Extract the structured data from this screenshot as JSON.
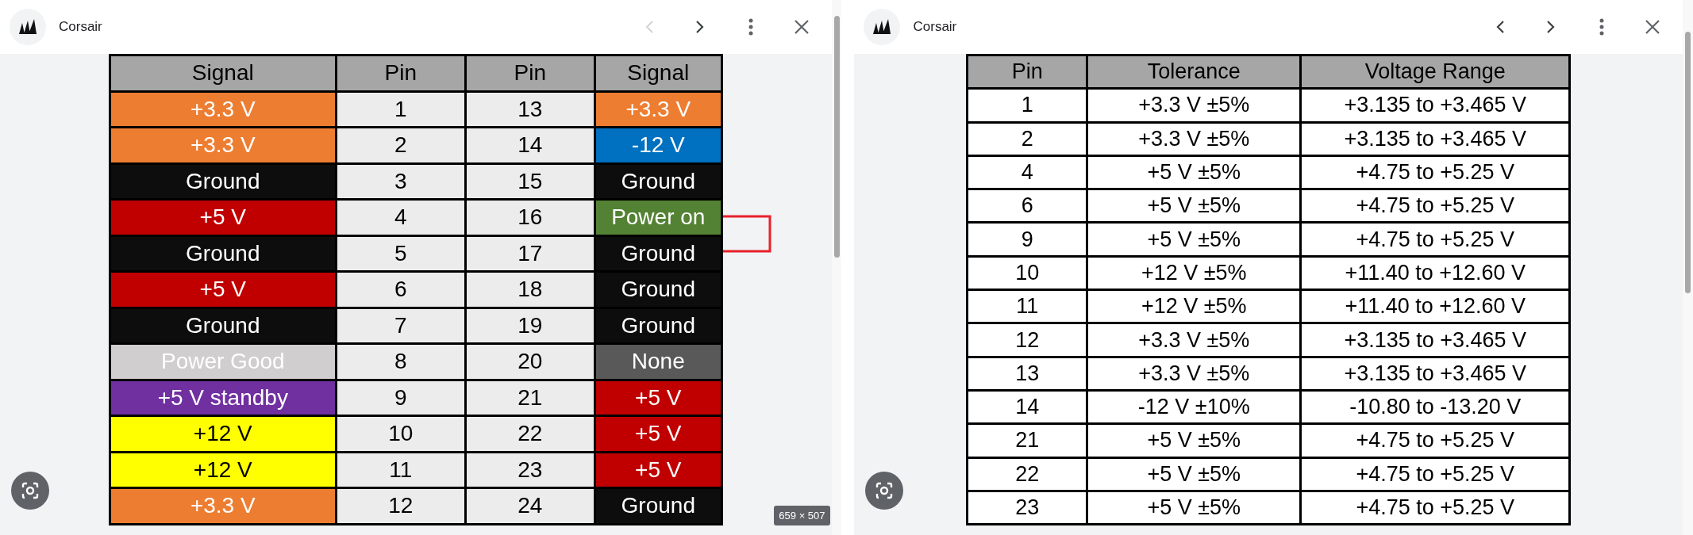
{
  "panels": [
    {
      "source": "Corsair",
      "prev_disabled": true,
      "size_badge": "659 × 507",
      "table": {
        "kind": "pinout",
        "columns": [
          "Signal",
          "Pin",
          "Pin",
          "Signal"
        ],
        "rows": [
          {
            "cells": [
              {
                "text": "+3.3 V",
                "color": "#ed7d31"
              },
              {
                "text": "1"
              },
              {
                "text": "13"
              },
              {
                "text": "+3.3 V",
                "color": "#ed7d31"
              }
            ]
          },
          {
            "cells": [
              {
                "text": "+3.3 V",
                "color": "#ed7d31"
              },
              {
                "text": "2"
              },
              {
                "text": "14"
              },
              {
                "text": "-12 V",
                "color": "#0070c0"
              }
            ]
          },
          {
            "cells": [
              {
                "text": "Ground",
                "color": "#0d0d0d"
              },
              {
                "text": "3"
              },
              {
                "text": "15"
              },
              {
                "text": "Ground",
                "color": "#0d0d0d"
              }
            ]
          },
          {
            "cells": [
              {
                "text": "+5 V",
                "color": "#c00000"
              },
              {
                "text": "4"
              },
              {
                "text": "16"
              },
              {
                "text": "Power on",
                "color": "#548235"
              }
            ]
          },
          {
            "cells": [
              {
                "text": "Ground",
                "color": "#0d0d0d"
              },
              {
                "text": "5"
              },
              {
                "text": "17"
              },
              {
                "text": "Ground",
                "color": "#0d0d0d"
              }
            ]
          },
          {
            "cells": [
              {
                "text": "+5 V",
                "color": "#c00000"
              },
              {
                "text": "6"
              },
              {
                "text": "18"
              },
              {
                "text": "Ground",
                "color": "#0d0d0d"
              }
            ]
          },
          {
            "cells": [
              {
                "text": "Ground",
                "color": "#0d0d0d"
              },
              {
                "text": "7"
              },
              {
                "text": "19"
              },
              {
                "text": "Ground",
                "color": "#0d0d0d"
              }
            ]
          },
          {
            "cells": [
              {
                "text": "Power Good",
                "color": "#d0cece"
              },
              {
                "text": "8"
              },
              {
                "text": "20"
              },
              {
                "text": "None",
                "color": "#595959"
              }
            ]
          },
          {
            "cells": [
              {
                "text": "+5 V standby",
                "color": "#7030a0"
              },
              {
                "text": "9"
              },
              {
                "text": "21"
              },
              {
                "text": "+5 V",
                "color": "#c00000"
              }
            ]
          },
          {
            "cells": [
              {
                "text": "+12 V",
                "color": "#ffff00"
              },
              {
                "text": "10"
              },
              {
                "text": "22"
              },
              {
                "text": "+5 V",
                "color": "#c00000"
              }
            ]
          },
          {
            "cells": [
              {
                "text": "+12 V",
                "color": "#ffff00"
              },
              {
                "text": "11"
              },
              {
                "text": "23"
              },
              {
                "text": "+5 V",
                "color": "#c00000"
              }
            ]
          },
          {
            "cells": [
              {
                "text": "+3.3 V",
                "color": "#ed7d31"
              },
              {
                "text": "12"
              },
              {
                "text": "24"
              },
              {
                "text": "Ground",
                "color": "#0d0d0d"
              }
            ]
          }
        ]
      }
    },
    {
      "source": "Corsair",
      "prev_disabled": false,
      "table": {
        "kind": "tolerance",
        "columns": [
          "Pin",
          "Tolerance",
          "Voltage Range"
        ],
        "rows": [
          {
            "cells": [
              {
                "text": "1"
              },
              {
                "text": "+3.3 V ±5%"
              },
              {
                "text": "+3.135 to +3.465 V"
              }
            ]
          },
          {
            "cells": [
              {
                "text": "2"
              },
              {
                "text": "+3.3 V ±5%"
              },
              {
                "text": "+3.135 to +3.465 V"
              }
            ]
          },
          {
            "cells": [
              {
                "text": "4"
              },
              {
                "text": "+5 V ±5%"
              },
              {
                "text": "+4.75 to +5.25 V"
              }
            ]
          },
          {
            "cells": [
              {
                "text": "6"
              },
              {
                "text": "+5 V ±5%"
              },
              {
                "text": "+4.75 to +5.25 V"
              }
            ]
          },
          {
            "cells": [
              {
                "text": "9"
              },
              {
                "text": "+5 V ±5%"
              },
              {
                "text": "+4.75 to +5.25 V"
              }
            ]
          },
          {
            "cells": [
              {
                "text": "10"
              },
              {
                "text": "+12 V ±5%"
              },
              {
                "text": "+11.40 to +12.60 V"
              }
            ]
          },
          {
            "cells": [
              {
                "text": "11"
              },
              {
                "text": "+12 V ±5%"
              },
              {
                "text": "+11.40 to +12.60 V"
              }
            ]
          },
          {
            "cells": [
              {
                "text": "12"
              },
              {
                "text": "+3.3 V ±5%"
              },
              {
                "text": "+3.135 to +3.465 V"
              }
            ]
          },
          {
            "cells": [
              {
                "text": "13"
              },
              {
                "text": "+3.3 V ±5%"
              },
              {
                "text": "+3.135 to +3.465 V"
              }
            ]
          },
          {
            "cells": [
              {
                "text": "14"
              },
              {
                "text": "-12 V ±10%"
              },
              {
                "text": "-10.80 to -13.20 V"
              }
            ]
          },
          {
            "cells": [
              {
                "text": "21"
              },
              {
                "text": "+5 V ±5%"
              },
              {
                "text": "+4.75 to +5.25 V"
              }
            ]
          },
          {
            "cells": [
              {
                "text": "22"
              },
              {
                "text": "+5 V ±5%"
              },
              {
                "text": "+4.75 to +5.25 V"
              }
            ]
          },
          {
            "cells": [
              {
                "text": "23"
              },
              {
                "text": "+5 V ±5%"
              },
              {
                "text": "+4.75 to +5.25 V"
              }
            ]
          }
        ]
      }
    }
  ]
}
